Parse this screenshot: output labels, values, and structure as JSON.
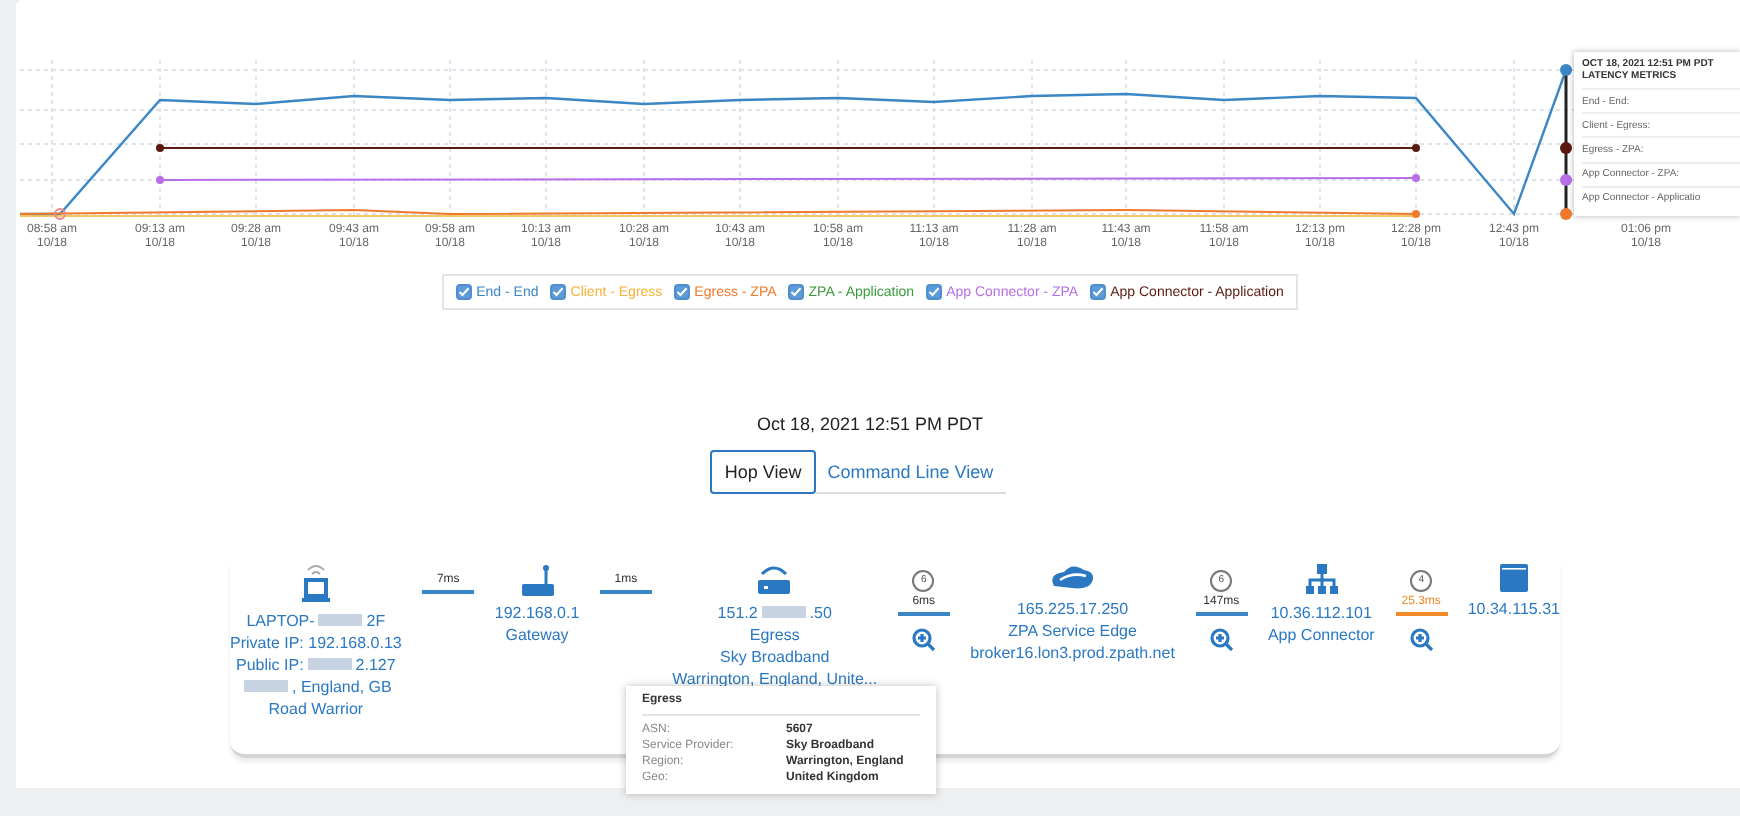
{
  "chart": {
    "x_labels": [
      {
        "time": "08:58 am",
        "date": "10/18"
      },
      {
        "time": "09:13 am",
        "date": "10/18"
      },
      {
        "time": "09:28 am",
        "date": "10/18"
      },
      {
        "time": "09:43 am",
        "date": "10/18"
      },
      {
        "time": "09:58 am",
        "date": "10/18"
      },
      {
        "time": "10:13 am",
        "date": "10/18"
      },
      {
        "time": "10:28 am",
        "date": "10/18"
      },
      {
        "time": "10:43 am",
        "date": "10/18"
      },
      {
        "time": "10:58 am",
        "date": "10/18"
      },
      {
        "time": "11:13 am",
        "date": "10/18"
      },
      {
        "time": "11:28 am",
        "date": "10/18"
      },
      {
        "time": "11:43 am",
        "date": "10/18"
      },
      {
        "time": "11:58 am",
        "date": "10/18"
      },
      {
        "time": "12:13 pm",
        "date": "10/18"
      },
      {
        "time": "12:28 pm",
        "date": "10/18"
      },
      {
        "time": "12:43 pm",
        "date": "10/18"
      },
      {
        "time": "01:06 pm",
        "date": "10/18"
      }
    ],
    "tooltip": {
      "title": "OCT 18, 2021 12:51 PM PDT",
      "subtitle": "LATENCY METRICS",
      "rows": [
        "End - End:",
        "Client - Egress:",
        "Egress - ZPA:",
        "App Connector - ZPA:",
        "App Connector - Applicatio"
      ]
    },
    "legend": [
      {
        "label": "End - End",
        "color": "#3b86c4",
        "checked": true
      },
      {
        "label": "Client - Egress",
        "color": "#f5b335",
        "checked": true
      },
      {
        "label": "Egress - ZPA",
        "color": "#f07a2c",
        "checked": true
      },
      {
        "label": "ZPA - Application",
        "color": "#3a9a3a",
        "checked": true
      },
      {
        "label": "App Connector - ZPA",
        "color": "#b76ee8",
        "checked": true
      },
      {
        "label": "App Connector - Application",
        "color": "#5a1a12",
        "checked": true
      }
    ]
  },
  "timestamp": "Oct 18, 2021 12:51 PM PDT",
  "views": [
    {
      "label": "Hop View",
      "selected": true
    },
    {
      "label": "Command Line View",
      "selected": false
    }
  ],
  "path": [
    {
      "kind": "laptop",
      "lines": [
        [
          {
            "kind": "text",
            "text": "LAPTOP-"
          },
          {
            "kind": "redacted"
          },
          {
            "kind": "text",
            "text": "2F"
          }
        ],
        [
          {
            "kind": "text",
            "text": "Private IP: 192.168.0.13"
          }
        ],
        [
          {
            "kind": "text",
            "text": "Public IP:"
          },
          {
            "kind": "redacted"
          },
          {
            "kind": "text",
            "text": "2.127"
          }
        ],
        [
          {
            "kind": "redacted"
          },
          {
            "kind": "text",
            "text": ", England, GB"
          }
        ],
        [
          {
            "kind": "text",
            "text": "Road Warrior"
          }
        ]
      ]
    },
    {
      "kind": "link",
      "latency": "7ms",
      "color": "#3b86c4"
    },
    {
      "kind": "router",
      "lines": [
        [
          {
            "kind": "text",
            "text": "192.168.0.1"
          }
        ],
        [
          {
            "kind": "text",
            "text": "Gateway"
          }
        ]
      ]
    },
    {
      "kind": "link",
      "latency": "1ms",
      "color": "#3b86c4"
    },
    {
      "kind": "modem",
      "lines": [
        [
          {
            "kind": "text",
            "text": "151.2"
          },
          {
            "kind": "redacted"
          },
          {
            "kind": "text",
            "text": ".50"
          }
        ],
        [
          {
            "kind": "text",
            "text": "Egress"
          }
        ],
        [
          {
            "kind": "text",
            "text": "Sky Broadband"
          }
        ],
        [
          {
            "kind": "text",
            "text": "Warrington, England, Unite..."
          }
        ]
      ]
    },
    {
      "kind": "link",
      "hops": "6",
      "latency": "6ms",
      "color": "#3b86c4",
      "zoom": true
    },
    {
      "kind": "cloud",
      "lines": [
        [
          {
            "kind": "text",
            "text": "165.225.17.250"
          }
        ],
        [
          {
            "kind": "text",
            "text": "ZPA Service Edge"
          }
        ],
        [
          {
            "kind": "text",
            "text": "broker16.lon3.prod.zpath.net"
          }
        ]
      ]
    },
    {
      "kind": "link",
      "hops": "6",
      "latency": "147ms",
      "color": "#3b86c4",
      "zoom": true
    },
    {
      "kind": "hierarchy",
      "lines": [
        [
          {
            "kind": "text",
            "text": "10.36.112.101"
          }
        ],
        [
          {
            "kind": "text",
            "text": "App Connector"
          }
        ]
      ]
    },
    {
      "kind": "link",
      "hops": "4",
      "latency": "25.3ms",
      "color": "#f08a2a",
      "zoom": true
    },
    {
      "kind": "window",
      "lines": [
        [
          {
            "kind": "text",
            "text": "10.34.115.31"
          }
        ]
      ]
    }
  ],
  "popup": {
    "title": "Egress",
    "rows": [
      {
        "label": "ASN:",
        "value": "5607"
      },
      {
        "label": "Service Provider:",
        "value": "Sky Broadband"
      },
      {
        "label": "Region:",
        "value": "Warrington, England"
      },
      {
        "label": "Geo:",
        "value": "United Kingdom"
      }
    ]
  }
}
